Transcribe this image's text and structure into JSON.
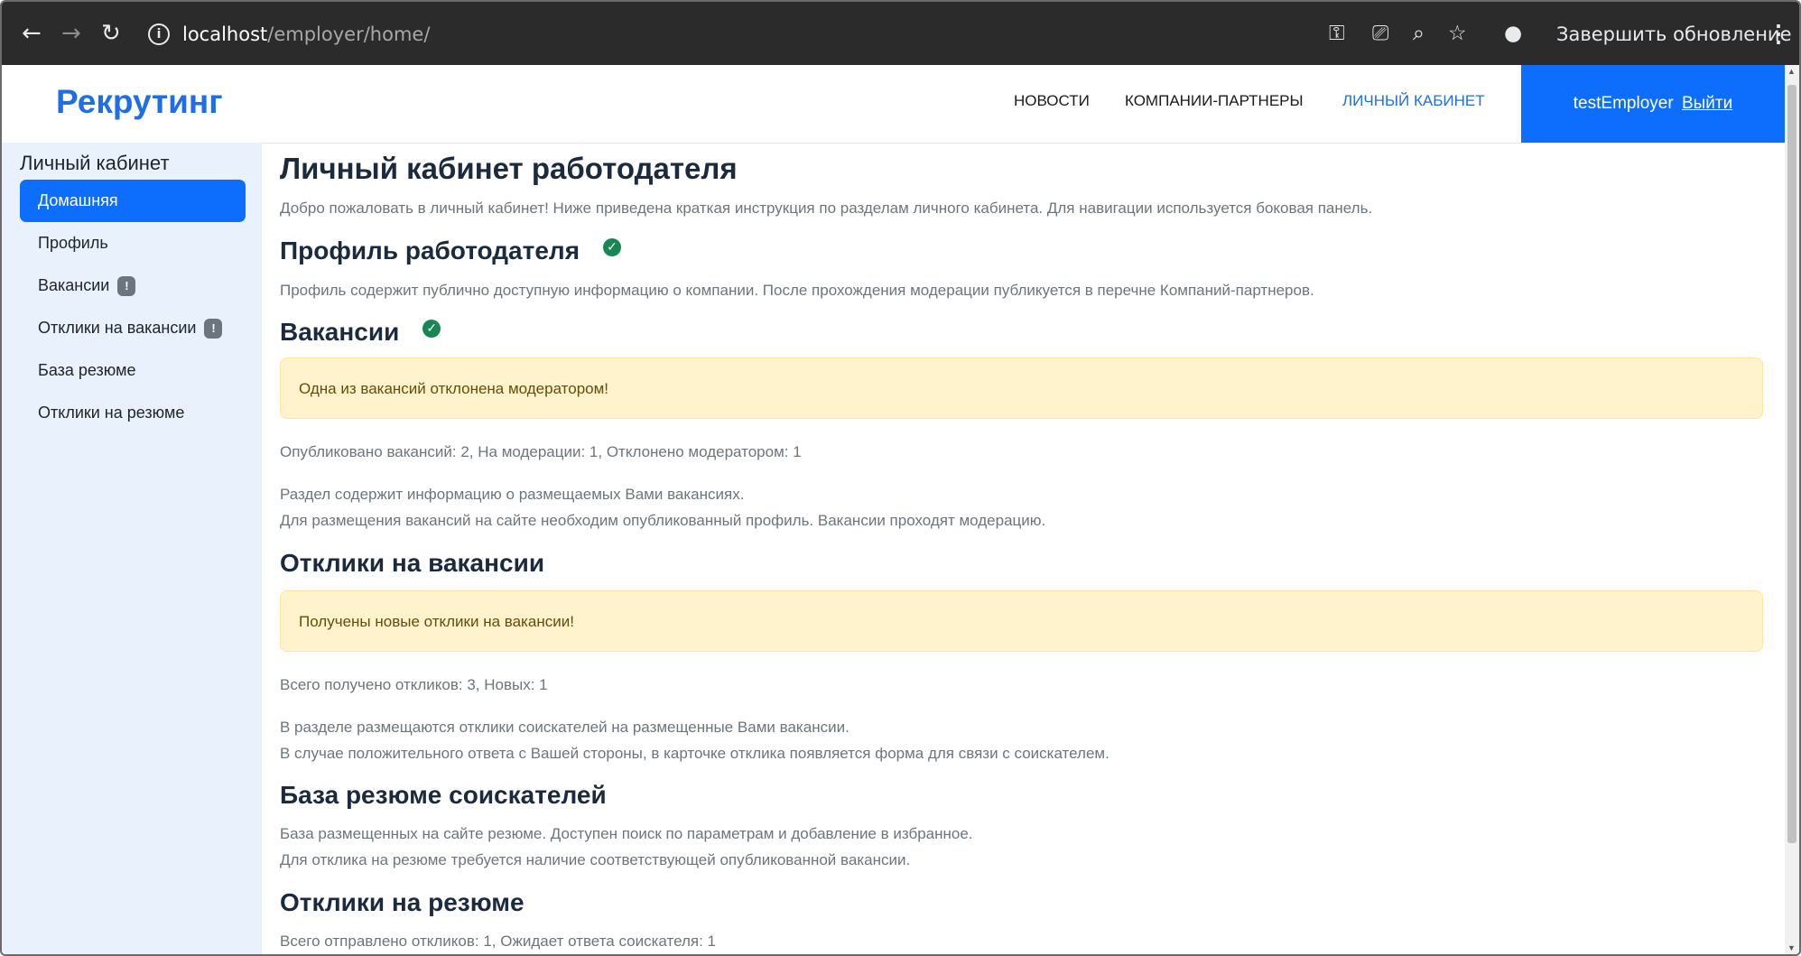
{
  "browser": {
    "url_host": "localhost",
    "url_path": "/employer/home/",
    "update_button": "Завершить обновление",
    "icons": [
      "back-icon",
      "forward-icon",
      "reload-icon",
      "info-icon",
      "key-icon",
      "cast-icon",
      "zoom-icon",
      "star-icon",
      "profile-icon",
      "menu-icon"
    ]
  },
  "header": {
    "brand": "Рекрутинг",
    "nav": [
      "НОВОСТИ",
      "КОМПАНИИ-ПАРТНЕРЫ",
      "ЛИЧНЫЙ КАБИНЕТ"
    ],
    "username": "testEmployer",
    "logout": "Выйти"
  },
  "sidebar": {
    "title": "Личный кабинет",
    "items": [
      {
        "label": "Домашняя",
        "badge": ""
      },
      {
        "label": "Профиль",
        "badge": ""
      },
      {
        "label": "Вакансии",
        "badge": "!"
      },
      {
        "label": "Отклики на вакансии",
        "badge": "!"
      },
      {
        "label": "База резюме",
        "badge": ""
      },
      {
        "label": "Отклики на резюме",
        "badge": ""
      }
    ]
  },
  "main": {
    "title": "Личный кабинет работодателя",
    "intro": "Добро пожаловать в личный кабинет! Ниже приведена краткая инструкция по разделам личного кабинета. Для навигации используется боковая панель.",
    "profile": {
      "title": "Профиль работодателя",
      "text": "Профиль содержит публично доступную информацию о компании. После прохождения модерации публикуется в перечне Компаний-партнеров."
    },
    "vacancies": {
      "title": "Вакансии",
      "alert": "Одна из вакансий отклонена модератором!",
      "stats": "Опубликовано вакансий: 2, На модерации: 1, Отклонено модератором: 1",
      "text1": "Раздел содержит информацию о размещаемых Вами вакансиях.",
      "text2": "Для размещения вакансий на сайте необходим опубликованный профиль. Вакансии проходят модерацию."
    },
    "responses": {
      "title": "Отклики на вакансии",
      "alert": "Получены новые отклики на вакансии!",
      "stats": "Всего получено откликов: 3, Новых: 1",
      "text1": "В разделе размещаются отклики соискателей на размещенные Вами вакансии.",
      "text2": "В случае положительного ответа с Вашей стороны, в карточке отклика появляется форма для связи с соискателем."
    },
    "resume_base": {
      "title": "База резюме соискателей",
      "text1": "База размещенных на сайте резюме. Доступен поиск по параметрам и добавление в избранное.",
      "text2": "Для отклика на резюме требуется наличие соответствующей опубликованной вакансии."
    },
    "resume_responses": {
      "title": "Отклики на резюме",
      "stats": "Всего отправлено откликов: 1, Ожидает ответа соискателя: 1"
    }
  }
}
